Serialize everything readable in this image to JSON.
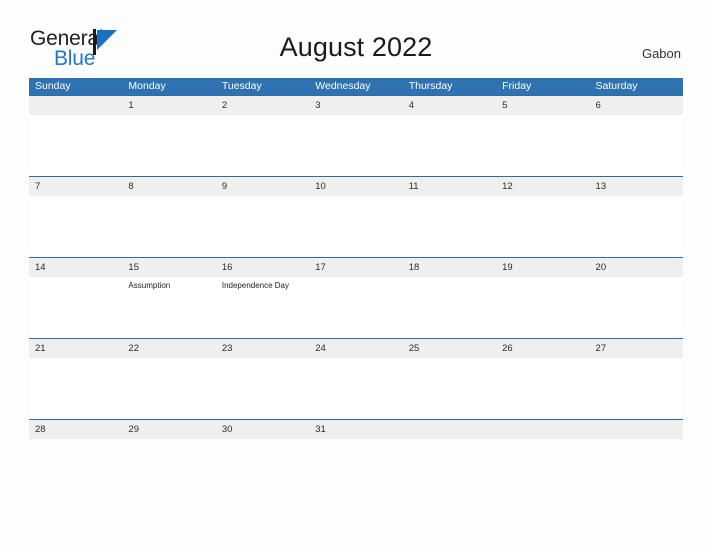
{
  "brand": {
    "name_part1": "General",
    "name_part2": "Blue",
    "mark_icon": "blue-triangle-flag-icon",
    "accent_color": "#2079c4"
  },
  "header": {
    "title": "August 2022",
    "region": "Gabon"
  },
  "theme": {
    "header_blue": "#2e72b2",
    "row_divider_blue": "#2e6da4",
    "date_band_gray": "#efefef",
    "page_background": "#fdfdfd"
  },
  "calendar": {
    "weekdays": [
      "Sunday",
      "Monday",
      "Tuesday",
      "Wednesday",
      "Thursday",
      "Friday",
      "Saturday"
    ],
    "weeks": [
      {
        "days": [
          {
            "date": "",
            "event": ""
          },
          {
            "date": "1",
            "event": ""
          },
          {
            "date": "2",
            "event": ""
          },
          {
            "date": "3",
            "event": ""
          },
          {
            "date": "4",
            "event": ""
          },
          {
            "date": "5",
            "event": ""
          },
          {
            "date": "6",
            "event": ""
          }
        ]
      },
      {
        "days": [
          {
            "date": "7",
            "event": ""
          },
          {
            "date": "8",
            "event": ""
          },
          {
            "date": "9",
            "event": ""
          },
          {
            "date": "10",
            "event": ""
          },
          {
            "date": "11",
            "event": ""
          },
          {
            "date": "12",
            "event": ""
          },
          {
            "date": "13",
            "event": ""
          }
        ]
      },
      {
        "days": [
          {
            "date": "14",
            "event": ""
          },
          {
            "date": "15",
            "event": "Assumption"
          },
          {
            "date": "16",
            "event": "Independence Day"
          },
          {
            "date": "17",
            "event": ""
          },
          {
            "date": "18",
            "event": ""
          },
          {
            "date": "19",
            "event": ""
          },
          {
            "date": "20",
            "event": ""
          }
        ]
      },
      {
        "days": [
          {
            "date": "21",
            "event": ""
          },
          {
            "date": "22",
            "event": ""
          },
          {
            "date": "23",
            "event": ""
          },
          {
            "date": "24",
            "event": ""
          },
          {
            "date": "25",
            "event": ""
          },
          {
            "date": "26",
            "event": ""
          },
          {
            "date": "27",
            "event": ""
          }
        ]
      },
      {
        "days": [
          {
            "date": "28",
            "event": ""
          },
          {
            "date": "29",
            "event": ""
          },
          {
            "date": "30",
            "event": ""
          },
          {
            "date": "31",
            "event": ""
          },
          {
            "date": "",
            "event": ""
          },
          {
            "date": "",
            "event": ""
          },
          {
            "date": "",
            "event": ""
          }
        ]
      }
    ]
  }
}
